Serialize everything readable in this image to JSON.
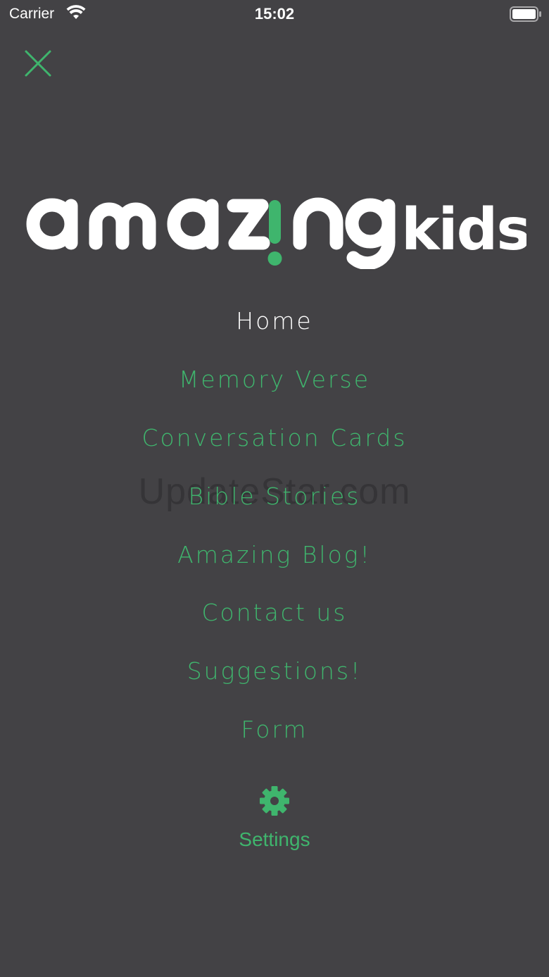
{
  "status_bar": {
    "carrier": "Carrier",
    "time": "15:02",
    "icons": [
      "wifi-icon",
      "battery-icon"
    ]
  },
  "header": {
    "close_icon": "close-icon"
  },
  "logo": {
    "word1": "amazing",
    "word2": "kids"
  },
  "menu": {
    "items": [
      {
        "label": "Home",
        "active": true
      },
      {
        "label": "Memory Verse",
        "active": false
      },
      {
        "label": "Conversation Cards",
        "active": false
      },
      {
        "label": "Bible Stories",
        "active": false
      },
      {
        "label": "Amazing Blog!",
        "active": false
      },
      {
        "label": "Contact us",
        "active": false
      },
      {
        "label": "Suggestions!",
        "active": false
      },
      {
        "label": "Form",
        "active": false
      }
    ]
  },
  "watermark": "UpdateStar.com",
  "settings": {
    "label": "Settings",
    "icon": "gear-icon"
  },
  "colors": {
    "background": "#434245",
    "accent": "#3fb56d",
    "active": "#ffffff"
  }
}
